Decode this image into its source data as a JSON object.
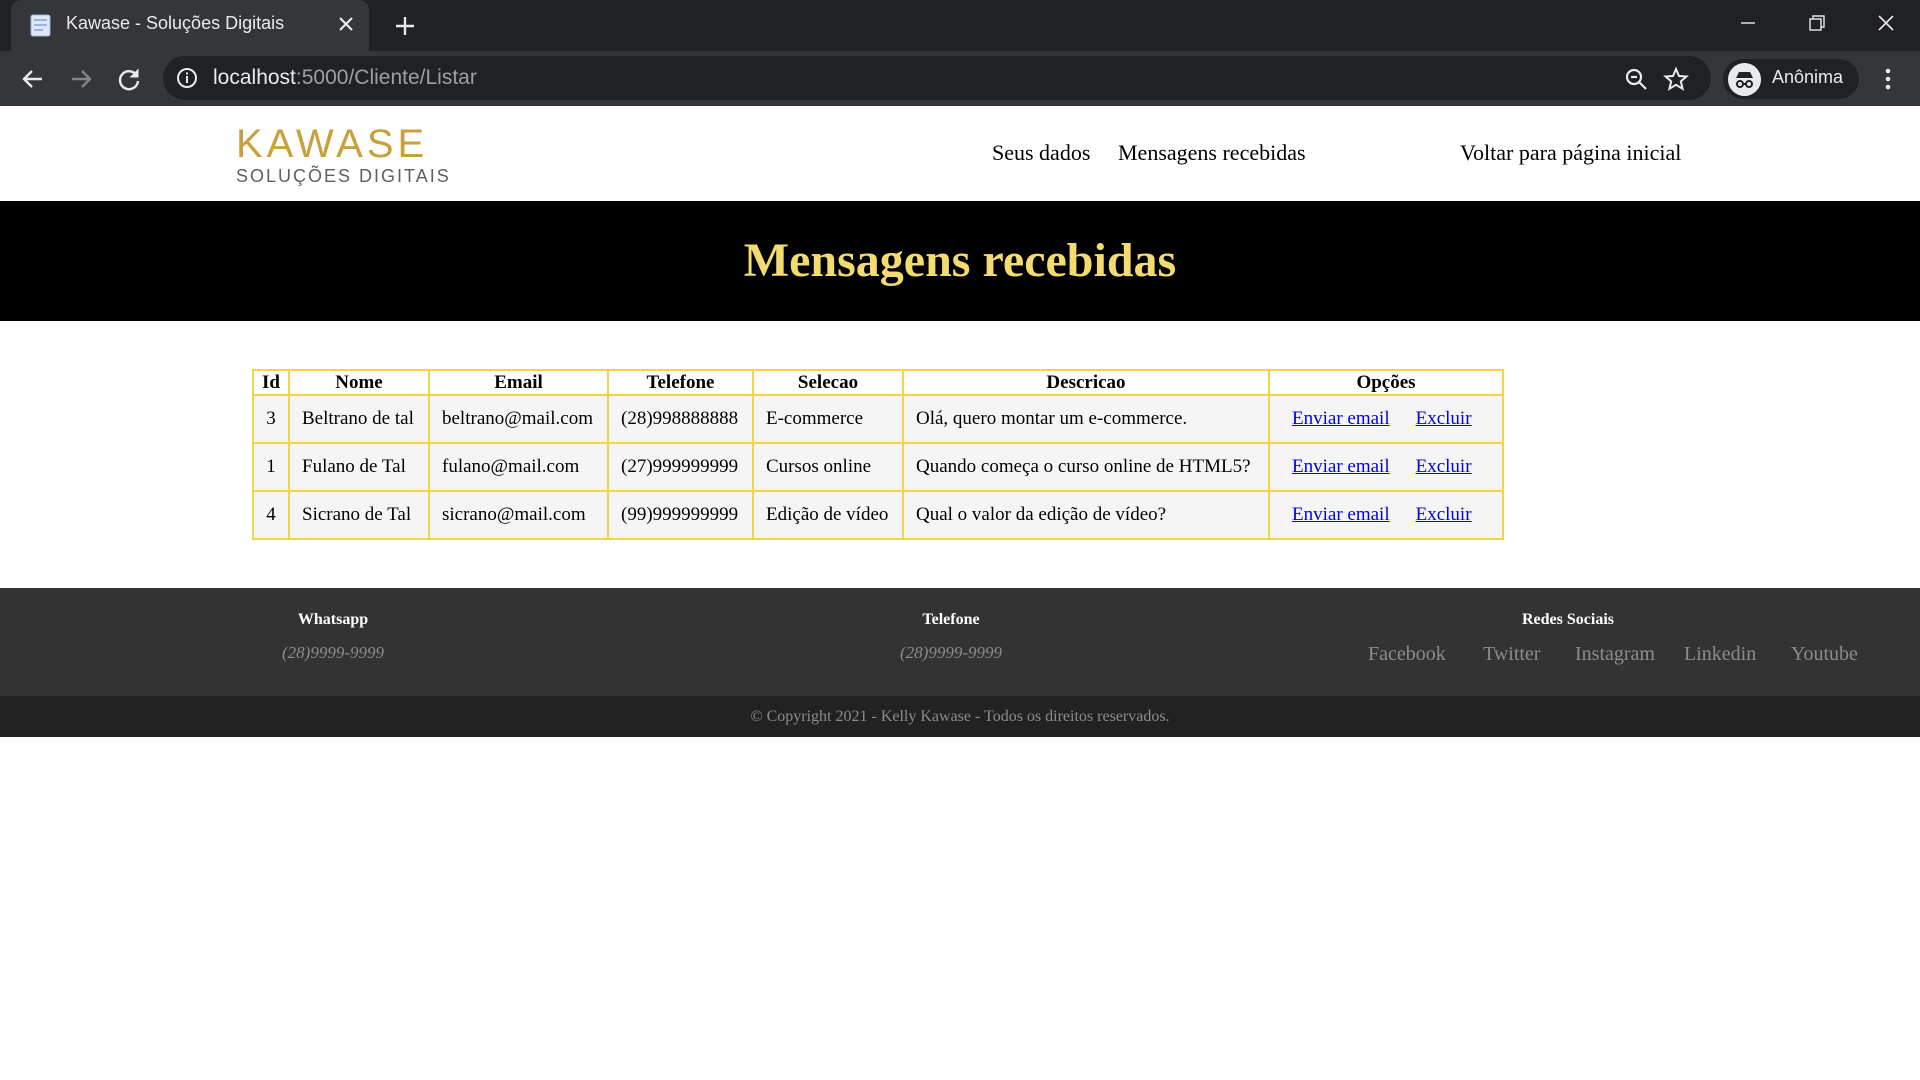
{
  "browser": {
    "tab_title": "Kawase - Soluções Digitais",
    "url_host": "localhost",
    "url_path": ":5000/Cliente/Listar",
    "profile_name": "Anônima"
  },
  "header": {
    "logo_main": "KAWASE",
    "logo_sub": "SOLUÇÕES DIGITAIS",
    "nav": {
      "dados": "Seus dados",
      "mensagens": "Mensagens recebidas",
      "voltar": "Voltar para página inicial"
    }
  },
  "banner": {
    "title": "Mensagens recebidas"
  },
  "table": {
    "headers": [
      "Id",
      "Nome",
      "Email",
      "Telefone",
      "Selecao",
      "Descricao",
      "Opções"
    ],
    "action_email": "Enviar email",
    "action_delete": "Excluir",
    "rows": [
      [
        "3",
        "Beltrano de tal",
        "beltrano@mail.com",
        "(28)998888888",
        "E-commerce",
        "Olá, quero montar um e-commerce."
      ],
      [
        "1",
        "Fulano de Tal",
        "fulano@mail.com",
        "(27)999999999",
        "Cursos online",
        "Quando começa o curso online de HTML5?"
      ],
      [
        "4",
        "Sicrano de Tal",
        "sicrano@mail.com",
        "(99)999999999",
        "Edição de vídeo",
        "Qual o valor da edição de vídeo?"
      ]
    ]
  },
  "footer": {
    "whatsapp_title": "Whatsapp",
    "whatsapp_value": "(28)9999-9999",
    "telefone_title": "Telefone",
    "telefone_value": "(28)9999-9999",
    "redes_title": "Redes Sociais",
    "socials": [
      "Facebook",
      "Twitter",
      "Instagram",
      "Linkedin",
      "Youtube"
    ],
    "copyright": "© Copyright 2021 - Kelly Kawase - Todos os direitos reservados."
  },
  "colors": {
    "banner_title": "#f4db70",
    "table_border": "#f3d34a",
    "footer_bg": "#333333",
    "copyright_bg": "#222222",
    "logo_gold": "#c8a13b"
  },
  "icons": [
    "page-icon",
    "close-icon",
    "plus-icon",
    "minimize-icon",
    "restore-icon",
    "window-close-icon",
    "back-arrow-icon",
    "forward-arrow-icon",
    "reload-icon",
    "info-icon",
    "zoom-icon",
    "star-icon",
    "incognito-icon",
    "more-vert-icon"
  ]
}
